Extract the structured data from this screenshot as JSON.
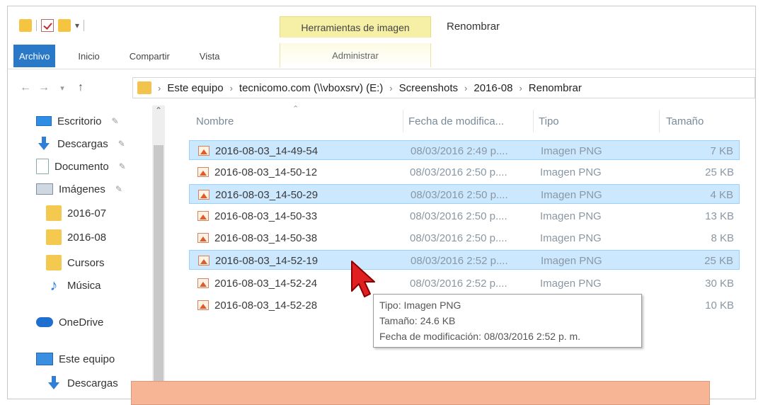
{
  "ribbon": {
    "context_tab": "Herramientas de imagen",
    "context_sub": "Administrar",
    "title": "Renombrar",
    "tabs": [
      "Archivo",
      "Inicio",
      "Compartir",
      "Vista"
    ]
  },
  "address": {
    "crumbs": [
      "Este equipo",
      "tecnicomo.com (\\\\vboxsrv) (E:)",
      "Screenshots",
      "2016-08",
      "Renombrar"
    ]
  },
  "sidebar": {
    "items": [
      {
        "label": "Escritorio",
        "icon": "desktop-icon",
        "pinned": true
      },
      {
        "label": "Descargas",
        "icon": "download-icon",
        "pinned": true
      },
      {
        "label": "Documento",
        "icon": "document-icon",
        "pinned": true
      },
      {
        "label": "Imágenes",
        "icon": "pictures-icon",
        "pinned": true
      },
      {
        "label": "2016-07",
        "icon": "folder-icon",
        "pinned": false
      },
      {
        "label": "2016-08",
        "icon": "folder-icon",
        "pinned": false
      },
      {
        "label": "Cursors",
        "icon": "folder-icon",
        "pinned": false
      },
      {
        "label": "Música",
        "icon": "music-icon",
        "pinned": false
      },
      {
        "label": "OneDrive",
        "icon": "onedrive-icon",
        "pinned": false
      },
      {
        "label": "Este equipo",
        "icon": "computer-icon",
        "pinned": false
      },
      {
        "label": "Descargas",
        "icon": "download-icon",
        "pinned": false
      }
    ]
  },
  "columns": {
    "name": "Nombre",
    "date": "Fecha de modifica...",
    "type": "Tipo",
    "size": "Tamaño"
  },
  "files": [
    {
      "name": "2016-08-03_14-49-54",
      "date": "08/03/2016 2:49 p....",
      "type": "Imagen PNG",
      "size": "7 KB",
      "selected": true
    },
    {
      "name": "2016-08-03_14-50-12",
      "date": "08/03/2016 2:50 p....",
      "type": "Imagen PNG",
      "size": "25 KB",
      "selected": false
    },
    {
      "name": "2016-08-03_14-50-29",
      "date": "08/03/2016 2:50 p....",
      "type": "Imagen PNG",
      "size": "4 KB",
      "selected": true
    },
    {
      "name": "2016-08-03_14-50-33",
      "date": "08/03/2016 2:50 p....",
      "type": "Imagen PNG",
      "size": "13 KB",
      "selected": false
    },
    {
      "name": "2016-08-03_14-50-38",
      "date": "08/03/2016 2:50 p....",
      "type": "Imagen PNG",
      "size": "8 KB",
      "selected": false
    },
    {
      "name": "2016-08-03_14-52-19",
      "date": "08/03/2016 2:52 p....",
      "type": "Imagen PNG",
      "size": "25 KB",
      "selected": true
    },
    {
      "name": "2016-08-03_14-52-24",
      "date": "08/03/2016 2:52 p....",
      "type": "Imagen PNG",
      "size": "30 KB",
      "selected": false
    },
    {
      "name": "2016-08-03_14-52-28",
      "date": "",
      "type": "",
      "size": "10 KB",
      "selected": false
    }
  ],
  "tooltip": {
    "type": "Tipo: Imagen PNG",
    "size": "Tamaño: 24.6 KB",
    "date": "Fecha de modificación: 08/03/2016 2:52 p. m."
  },
  "colors": {
    "accent": "#2a79c9",
    "selection": "#cce8ff",
    "context_tab": "#f6f0a6",
    "overlay": "#f7b596",
    "cursor": "#e02020"
  }
}
